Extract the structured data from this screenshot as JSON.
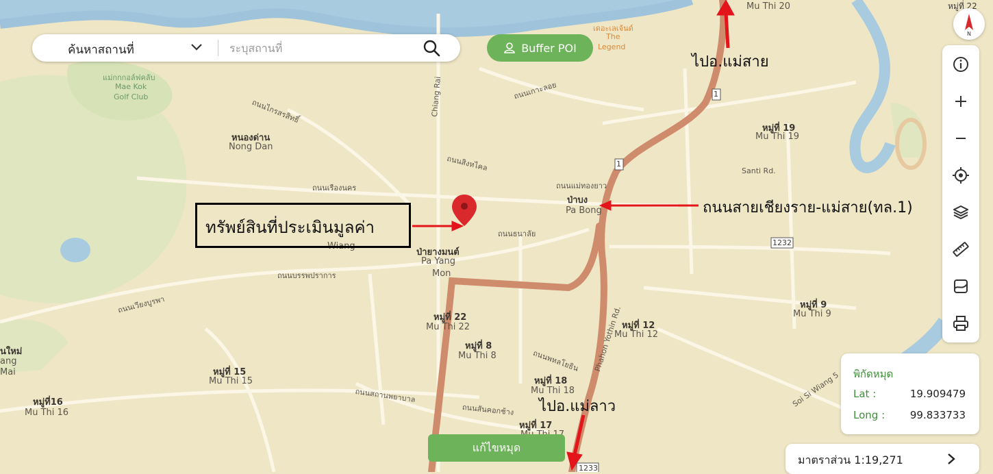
{
  "search": {
    "category_label": "ค้นหาสถานที่",
    "placeholder": "ระบุสถานที่"
  },
  "buffer_button": {
    "label": "Buffer POI"
  },
  "toolbar": {
    "compass_label": "N",
    "icons": [
      "info-icon",
      "zoom-in-icon",
      "zoom-out-icon",
      "locate-icon",
      "layers-icon",
      "ruler-icon",
      "map-style-icon",
      "print-icon"
    ]
  },
  "coordinates": {
    "title": "พิกัดหมุด",
    "lat_label": "Lat :",
    "lat_value": "19.909479",
    "long_label": "Long :",
    "long_value": "99.833733"
  },
  "scale": {
    "label": "มาตราส่วน",
    "value": "1:19,271"
  },
  "edit_button": {
    "label": "แก้ไขหมุด"
  },
  "annotations": {
    "property": "ทรัพย์สินที่ประเมินมูลค่า",
    "to_mae_sai": "ไปอ.แม่สาย",
    "highway": "ถนนสายเชียงราย-แม่สาย(ทล.1)",
    "to_mae_lao": "ไปอ.แม่ลาว"
  },
  "map_labels": {
    "mu_thi_20_en": "Mu Thi 20",
    "mu_thi_22_th_top": "หมู่ที่ 22",
    "golf_th": "แม่กกกอล์ฟคลับ",
    "golf_en1": "Mae Kok",
    "golf_en2": "Golf Club",
    "legend_th": "เดอะเลเจ้นด์",
    "legend_en1": "The",
    "legend_en2": "Legend",
    "nong_dan_th": "หนองด่าน",
    "nong_dan_en": "Nong Dan",
    "mu_thi_19_th": "หมู่ที่ 19",
    "mu_thi_19_en": "Mu Thi 19",
    "santi_rd": "Santi Rd.",
    "pa_bong_th": "ป่าบง",
    "pa_bong_en": "Pa Bong",
    "wiang_en": "Wiang",
    "pa_yang_mon_th": "ป่ายางมนต์",
    "pa_yang_en": "Pa Yang",
    "mon_en": "Mon",
    "mu_thi_9_th": "หมู่ที่ 9",
    "mu_thi_9_en": "Mu Thi 9",
    "mu_thi_22_th": "หมู่ที่ 22",
    "mu_thi_22_en": "Mu Thi 22",
    "mu_thi_8_th": "หมู่ที่ 8",
    "mu_thi_8_en": "Mu Thi 8",
    "mu_thi_12_th": "หมู่ที่ 12",
    "mu_thi_12_en": "Mu Thi 12",
    "mu_thi_18_th": "หมู่ที่ 18",
    "mu_thi_18_en": "Mu Thi 18",
    "mu_thi_17_th": "หมู่ที่ 17",
    "mu_thi_17_en": "Mu Thi 17",
    "mu_thi_15_th": "หมู่ที่ 15",
    "mu_thi_15_en": "Mu Thi 15",
    "mu_thi_16_th": "หมู่ที่16",
    "mu_thi_16_en": "Mu Thi 16",
    "nai_th": "นใหม่",
    "nai_en1": "ang",
    "nai_en2": "Mai",
    "phahon_rd": "Phahon Yothin Rd.",
    "chiang_rai_rd": "Chiang Rai",
    "soi_wiang": "Soi Si Wiang 5",
    "route_1_a": "1",
    "route_1_b": "1",
    "route_1232": "1232",
    "route_1233": "1233",
    "rd_1": "ถนนเรืองนคร",
    "rd_2": "ถนนสิงหไคล",
    "rd_3": "ถนนแม่ทองยาว",
    "rd_4": "ถนนธนาลัย",
    "rd_5": "ถนนบรรพปราการ",
    "rd_6": "ถนนพหลโยธิน",
    "rd_7": "ถนนสถานพยาบาล",
    "rd_8": "ถนนสันคอกช้าง",
    "rd_9": "ถนนเกาะลอย",
    "rd_10": "ถนนไกรสรสิทธิ์",
    "rd_11": "ถนนเวียงบูรพา"
  }
}
